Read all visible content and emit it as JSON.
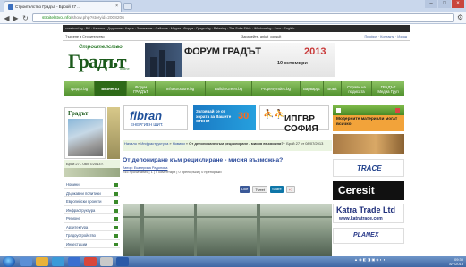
{
  "browser": {
    "tab_title": "Строителство Градът - Броой 27 ...",
    "url_host": "stroitelstvo.info",
    "url_path": "/show.php?storyid=2008206"
  },
  "site": {
    "top_strip": "construct.bg · BG · Каталог · Доделяне · Карта · Запитване · Сайтове · Медии · Форум · Градът.bg · Pakering · The Softe Ethic · Windows.bg · Блог · English",
    "search_label": "Търсене в Строителство",
    "user_text": "Здравейте, ankat_consult",
    "user_links": "Профил · Контакти · Изход",
    "logo_top": "Строителство",
    "logo_main": "Градът",
    "logo_sub": "online",
    "forum_title": "ФОРУМ ГРАДЪТ",
    "forum_year": "2013",
    "forum_date": "10 октомври",
    "nav": [
      "Градът.bg",
      "Бизнесът",
      "Форум ГРАДЪТ",
      "Infrastructure.bg",
      "BuildInGreen.bg",
      "PropertyIndex.bg",
      "Варварус",
      "BuBit",
      "Справи на подисата",
      "ГРАДЪТ Медиа Груп"
    ],
    "mag_head": "Градът",
    "issue": "Брой 27 - 08/07/2013 г.",
    "sidemenu": [
      "Новини",
      "Държавни политики",
      "Европейски проекти",
      "Инфраструктура",
      "Регионе",
      "Архитектура",
      "Градоустройство",
      "Инвестиции"
    ],
    "fibran_title": "fibran",
    "fibran_sub": "ЕНЕРГИЕН ЩИТ.",
    "blue_text": "Загрявай се от хората за Вашите СТЕНИ",
    "blue_num": "30",
    "ipgvr": "ИПГВР СОФИЯ",
    "crumb_links": [
      "Начало",
      "Инфраструктура",
      "Новини"
    ],
    "crumb_text": "От депониране към рециклиране - мисия възможна?",
    "crumb_issue": "Брой 27 от 08/07/2013",
    "article_title": "От депониране към рециклиране - мисия възможна?",
    "article_author": "Автор: Екатерина Радонова",
    "article_meta": "245 прочитания | 1 | 0 коментари | 0 препоръки | 0 препоръки",
    "share": [
      "Like",
      "Tweet",
      "Share",
      "+1"
    ],
    "ad_orange": "Модерните материали могат всичко",
    "trace": "TRACE",
    "ceresit": "Ceresit",
    "katra": "Katra Trade Ltd",
    "katra_url": "www.katratrade.com",
    "planex": "PLANEX"
  },
  "taskbar": {
    "time": "09:30",
    "date": "8/7/2013"
  },
  "colors": {
    "nav_green": "#4f8f2d",
    "link_blue": "#2a4a9a",
    "forum_red": "#c83838"
  }
}
